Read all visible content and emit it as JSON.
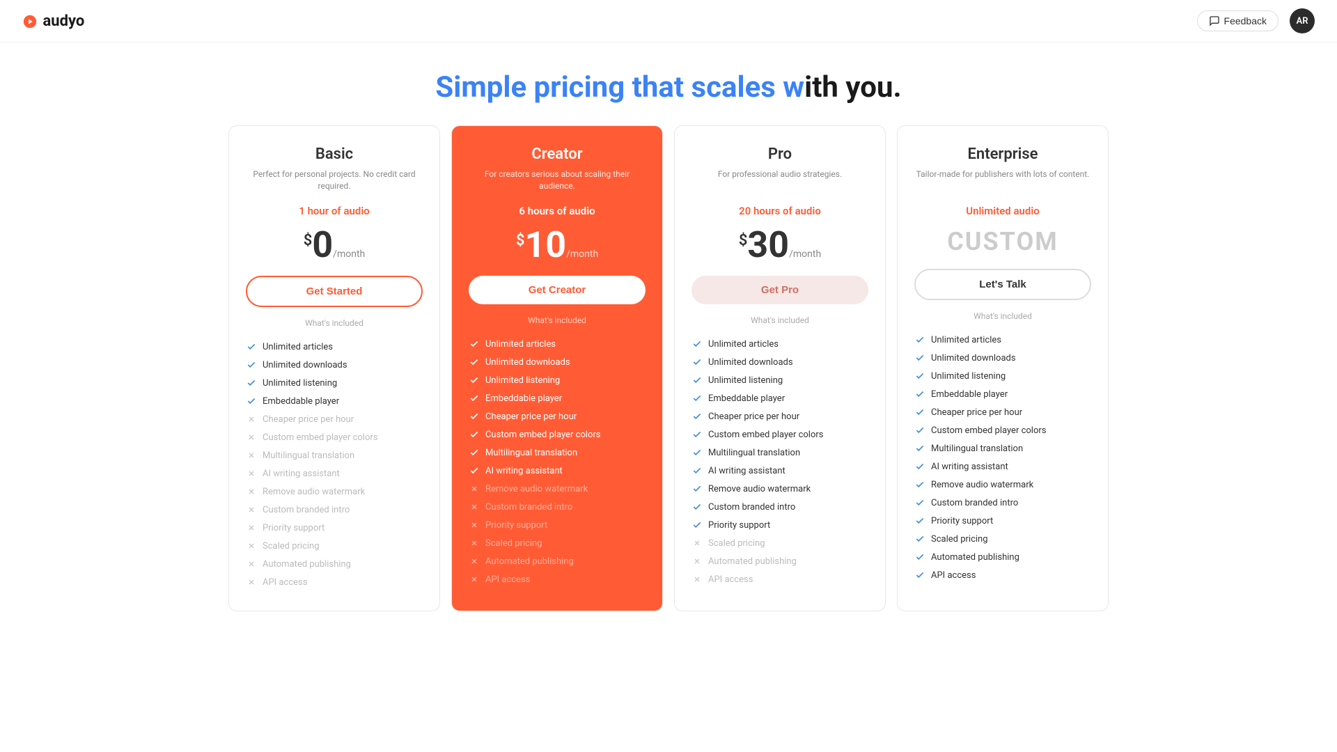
{
  "header": {
    "logo": "audyo",
    "feedback_label": "Feedback",
    "avatar_initials": "AR"
  },
  "page_title": {
    "highlight": "Simple pricing that scales w",
    "rest": "ith you."
  },
  "plans": [
    {
      "id": "basic",
      "name": "Basic",
      "desc": "Perfect for personal projects. No credit card required.",
      "audio": "1 hour of audio",
      "price_symbol": "$",
      "price_amount": "0",
      "price_period": "/month",
      "custom_price": null,
      "btn_label": "Get Started",
      "btn_class": "btn-basic",
      "features": [
        {
          "text": "Unlimited articles",
          "included": true,
          "type": "blue"
        },
        {
          "text": "Unlimited downloads",
          "included": true,
          "type": "blue"
        },
        {
          "text": "Unlimited listening",
          "included": true,
          "type": "blue"
        },
        {
          "text": "Embeddable player",
          "included": true,
          "type": "blue"
        },
        {
          "text": "Cheaper price per hour",
          "included": false,
          "type": "cross"
        },
        {
          "text": "Custom embed player colors",
          "included": false,
          "type": "cross"
        },
        {
          "text": "Multilingual translation",
          "included": false,
          "type": "cross"
        },
        {
          "text": "AI writing assistant",
          "included": false,
          "type": "cross"
        },
        {
          "text": "Remove audio watermark",
          "included": false,
          "type": "cross"
        },
        {
          "text": "Custom branded intro",
          "included": false,
          "type": "cross"
        },
        {
          "text": "Priority support",
          "included": false,
          "type": "cross"
        },
        {
          "text": "Scaled pricing",
          "included": false,
          "type": "cross"
        },
        {
          "text": "Automated publishing",
          "included": false,
          "type": "cross"
        },
        {
          "text": "API access",
          "included": false,
          "type": "cross"
        }
      ]
    },
    {
      "id": "creator",
      "name": "Creator",
      "desc": "For creators serious about scaling their audience.",
      "audio": "6 hours of audio",
      "price_symbol": "$",
      "price_amount": "10",
      "price_period": "/month",
      "custom_price": null,
      "btn_label": "Get Creator",
      "btn_class": "btn-creator",
      "features": [
        {
          "text": "Unlimited articles",
          "included": true,
          "type": "white"
        },
        {
          "text": "Unlimited downloads",
          "included": true,
          "type": "white"
        },
        {
          "text": "Unlimited listening",
          "included": true,
          "type": "white"
        },
        {
          "text": "Embeddable player",
          "included": true,
          "type": "white"
        },
        {
          "text": "Cheaper price per hour",
          "included": true,
          "type": "white"
        },
        {
          "text": "Custom embed player colors",
          "included": true,
          "type": "white"
        },
        {
          "text": "Multilingual translation",
          "included": true,
          "type": "white"
        },
        {
          "text": "AI writing assistant",
          "included": true,
          "type": "white"
        },
        {
          "text": "Remove audio watermark",
          "included": false,
          "type": "cross"
        },
        {
          "text": "Custom branded intro",
          "included": false,
          "type": "cross"
        },
        {
          "text": "Priority support",
          "included": false,
          "type": "cross"
        },
        {
          "text": "Scaled pricing",
          "included": false,
          "type": "cross"
        },
        {
          "text": "Automated publishing",
          "included": false,
          "type": "cross"
        },
        {
          "text": "API access",
          "included": false,
          "type": "cross"
        }
      ]
    },
    {
      "id": "pro",
      "name": "Pro",
      "desc": "For professional audio strategies.",
      "audio": "20 hours of audio",
      "price_symbol": "$",
      "price_amount": "30",
      "price_period": "/month",
      "custom_price": null,
      "btn_label": "Get Pro",
      "btn_class": "btn-pro",
      "features": [
        {
          "text": "Unlimited articles",
          "included": true,
          "type": "blue"
        },
        {
          "text": "Unlimited downloads",
          "included": true,
          "type": "blue"
        },
        {
          "text": "Unlimited listening",
          "included": true,
          "type": "blue"
        },
        {
          "text": "Embeddable player",
          "included": true,
          "type": "blue"
        },
        {
          "text": "Cheaper price per hour",
          "included": true,
          "type": "blue"
        },
        {
          "text": "Custom embed player colors",
          "included": true,
          "type": "blue"
        },
        {
          "text": "Multilingual translation",
          "included": true,
          "type": "blue"
        },
        {
          "text": "AI writing assistant",
          "included": true,
          "type": "blue"
        },
        {
          "text": "Remove audio watermark",
          "included": true,
          "type": "blue"
        },
        {
          "text": "Custom branded intro",
          "included": true,
          "type": "blue"
        },
        {
          "text": "Priority support",
          "included": true,
          "type": "blue"
        },
        {
          "text": "Scaled pricing",
          "included": false,
          "type": "cross"
        },
        {
          "text": "Automated publishing",
          "included": false,
          "type": "cross"
        },
        {
          "text": "API access",
          "included": false,
          "type": "cross"
        }
      ]
    },
    {
      "id": "enterprise",
      "name": "Enterprise",
      "desc": "Tailor-made for publishers with lots of content.",
      "audio": "Unlimited audio",
      "price_symbol": null,
      "price_amount": null,
      "price_period": null,
      "custom_price": "CUSTOM",
      "btn_label": "Let's Talk",
      "btn_class": "btn-enterprise",
      "features": [
        {
          "text": "Unlimited articles",
          "included": true,
          "type": "blue"
        },
        {
          "text": "Unlimited downloads",
          "included": true,
          "type": "blue"
        },
        {
          "text": "Unlimited listening",
          "included": true,
          "type": "blue"
        },
        {
          "text": "Embeddable player",
          "included": true,
          "type": "blue"
        },
        {
          "text": "Cheaper price per hour",
          "included": true,
          "type": "blue"
        },
        {
          "text": "Custom embed player colors",
          "included": true,
          "type": "blue"
        },
        {
          "text": "Multilingual translation",
          "included": true,
          "type": "blue"
        },
        {
          "text": "AI writing assistant",
          "included": true,
          "type": "blue"
        },
        {
          "text": "Remove audio watermark",
          "included": true,
          "type": "blue"
        },
        {
          "text": "Custom branded intro",
          "included": true,
          "type": "blue"
        },
        {
          "text": "Priority support",
          "included": true,
          "type": "blue"
        },
        {
          "text": "Scaled pricing",
          "included": true,
          "type": "blue"
        },
        {
          "text": "Automated publishing",
          "included": true,
          "type": "blue"
        },
        {
          "text": "API access",
          "included": true,
          "type": "blue"
        }
      ]
    }
  ],
  "whats_included_label": "What's included"
}
